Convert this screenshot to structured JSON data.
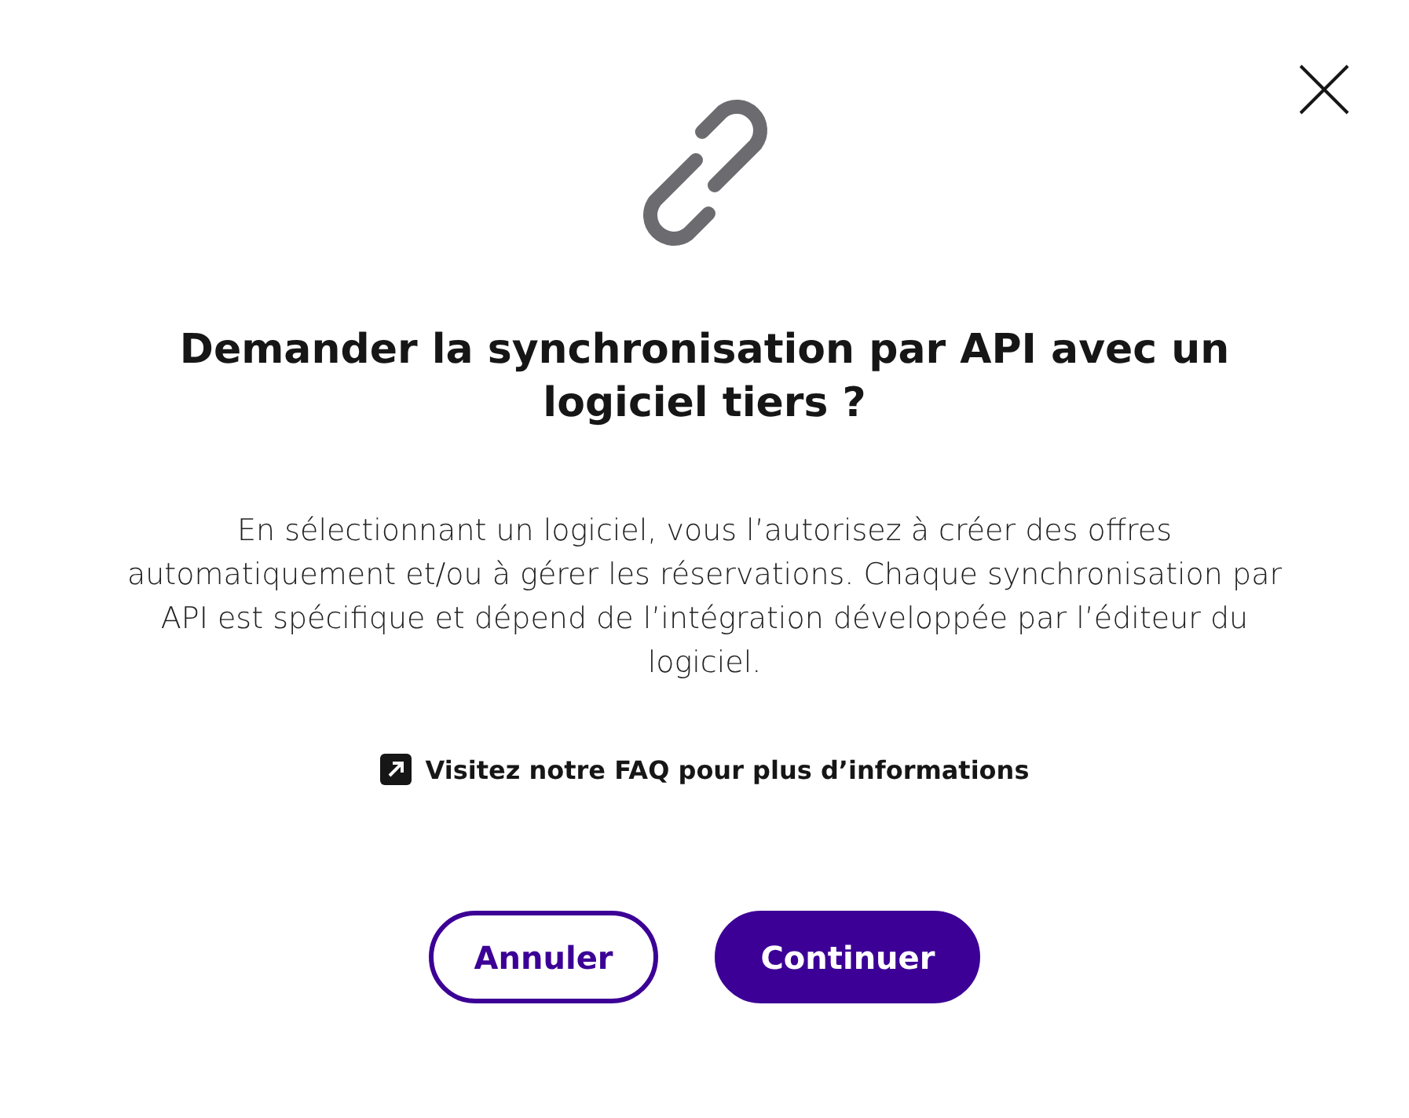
{
  "dialog": {
    "title": "Demander la synchronisation par API avec un logiciel tiers ?",
    "body": "En sélectionnant un logiciel, vous l’autorisez à créer des offres automatiquement et/ou à gérer les réservations. Chaque synchronisation par API est spécifique et dépend de l’intégration développée par l’éditeur du logiciel.",
    "link": "Visitez notre FAQ pour plus d’informations",
    "buttons": [
      {
        "label": "Annuler",
        "kind": "secondary"
      },
      {
        "label": "Continuer",
        "kind": "primary"
      }
    ]
  }
}
